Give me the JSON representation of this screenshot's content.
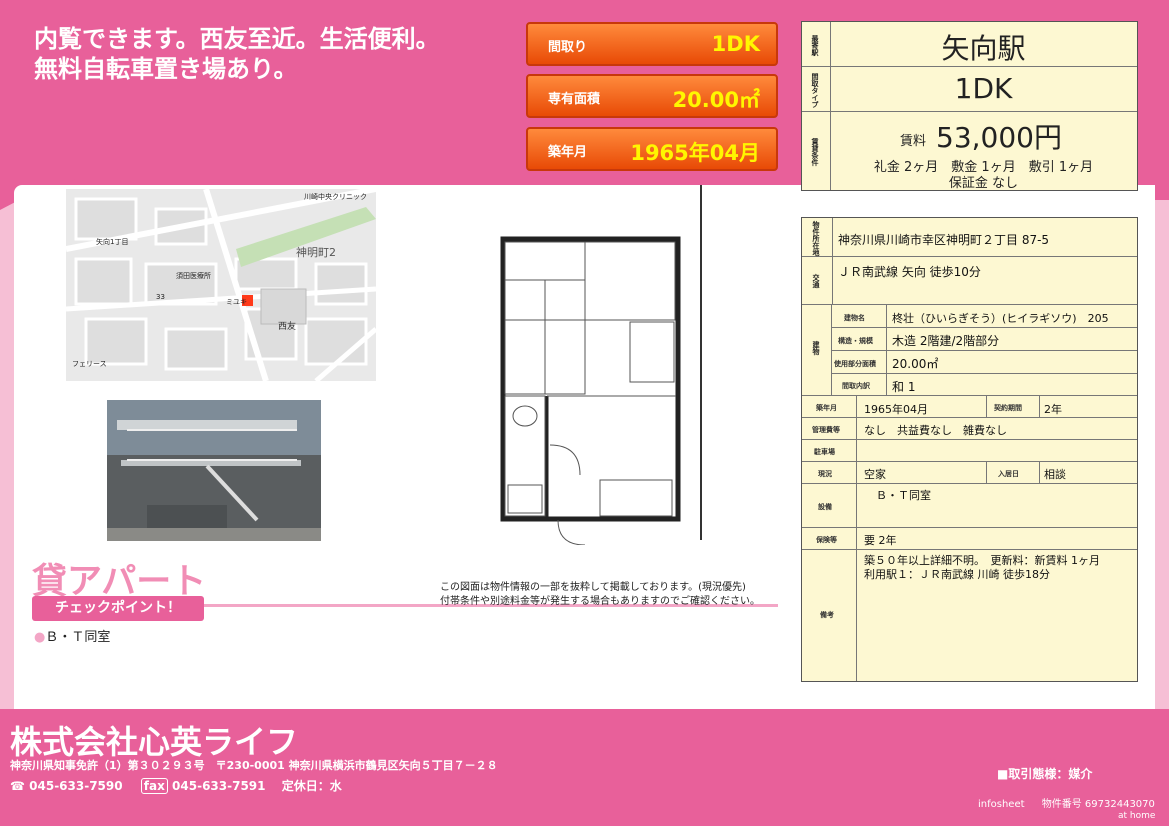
{
  "header": {
    "catch_copy": "内覧できます。西友至近。生活便利。\n無料自転車置き場あり。",
    "specs": [
      {
        "label": "間取り",
        "value": "1DK"
      },
      {
        "label": "専有面積",
        "value": "20.00㎡"
      },
      {
        "label": "築年月",
        "value": "1965年04月"
      }
    ]
  },
  "summary": {
    "station_label": "最寄駅",
    "station": "矢向駅",
    "layout_label": "間取タイプ",
    "layout": "1DK",
    "rent_conditions_label": "賃貸条件",
    "rent_label": "賃料",
    "rent": "53,000円",
    "fees_line1": "礼金 2ヶ月　敷金 1ヶ月　敷引 1ヶ月",
    "fees_line2": "保証金 なし"
  },
  "details": {
    "address_label": "物件所在地",
    "address": "神奈川県川崎市幸区神明町２丁目 87-5",
    "access_label": "交通",
    "access": "ＪＲ南武線 矢向 徒歩10分",
    "building_label": "建物",
    "name_label": "建物名",
    "name": "柊壮（ひいらぎそう）(ヒイラギソウ)　205",
    "structure_label": "構造・規模",
    "structure": "木造 2階建/2階部分",
    "area_label": "使用部分面積",
    "area": "20.00㎡",
    "rooms_label": "間取内訳",
    "rooms": "和 1",
    "built_label": "築年月",
    "built": "1965年04月",
    "contract_label": "契約期間",
    "contract": "2年",
    "mgmt_label": "管理費等",
    "mgmt": "なし　共益費なし　雑費なし",
    "parking_label": "駐車場",
    "parking": "",
    "status_label": "現況",
    "status": "空家",
    "movein_label": "入居日",
    "movein": "相談",
    "facilities_label": "設備",
    "facilities": "Ｂ・Ｔ同室",
    "insurance_label": "保険等",
    "insurance": "要 2年",
    "remarks_label": "備考",
    "remarks_line1": "築５０年以上詳細不明。　更新料：新賃料 1ヶ月",
    "remarks_line2": "利用駅１：ＪＲ南武線 川崎 徒歩18分"
  },
  "map": {
    "street_label": "神明町2",
    "store_label": "西友",
    "clinic_label": "川崎中央クリニック",
    "number_label": "33",
    "place_labels": [
      "矢向1丁目",
      "須田医療所",
      "ミユキ",
      "フェリース"
    ]
  },
  "type": {
    "title": "貸アパート",
    "check_label": "チェックポイント！",
    "check_item": "Ｂ・Ｔ同室"
  },
  "notice": {
    "line1": "この図面は物件情報の一部を抜粋して掲載しております。(現況優先)",
    "line2": "付帯条件や別途料金等が発生する場合もありますのでご確認ください。"
  },
  "footer": {
    "company": "株式会社心英ライフ",
    "license": "神奈川県知事免許（1）第３０２９３号　〒230-0001 神奈川県横浜市鶴見区矢向５丁目７－２８",
    "tel_label": "☎",
    "tel": "045-633-7590",
    "fax_label": "fax",
    "fax": "045-633-7591",
    "holiday": "定休日：水",
    "transaction": "■取引態様：媒介",
    "infosheet": "infosheet",
    "property_no_label": "物件番号",
    "property_no": "69732443070",
    "athome": "at home"
  }
}
